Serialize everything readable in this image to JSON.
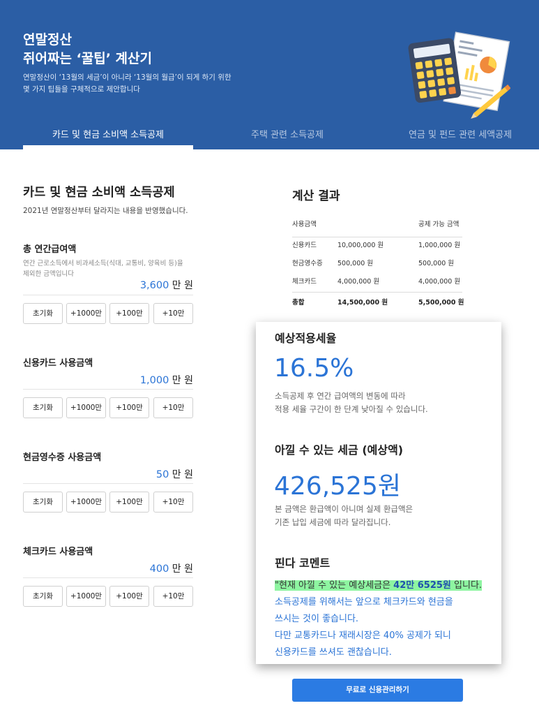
{
  "header": {
    "title_line1": "연말정산",
    "title_line2": "쥐어짜는 ‘꿀팁’ 계산기",
    "desc_line1": "연말정산이 ‘13월의 세금’이 아니라 ‘13월의 월급’이 되게 하기 위한",
    "desc_line2": "몇 가지 팁들을 구체적으로 제안합니다",
    "illustration_icon": "calculator-document-pencil-illustration"
  },
  "tabs": [
    {
      "label": "카드 및 현금 소비액 소득공제",
      "active": true
    },
    {
      "label": "주택 관련 소득공제",
      "active": false
    },
    {
      "label": "연금 및 펀드 관련 세액공제",
      "active": false
    }
  ],
  "form": {
    "title": "카드 및 현금 소비액 소득공제",
    "subtitle": "2021년 연말정산부터 달라지는 내용을 반영했습니다.",
    "unit": "만 원",
    "buttons": [
      "초기화",
      "+1000만",
      "+100만",
      "+10만"
    ],
    "fields": [
      {
        "label": "총 연간급여액",
        "help1": "연간 근로소득에서 비과세소득(식대, 교통비, 양육비 등)을",
        "help2": "제외한 금액입니다",
        "value": "3,600"
      },
      {
        "label": "신용카드 사용금액",
        "value": "1,000"
      },
      {
        "label": "현금영수증 사용금액",
        "value": "50"
      },
      {
        "label": "체크카드 사용금액",
        "value": "400"
      }
    ]
  },
  "result": {
    "title": "계산 결과",
    "header": {
      "used": "사용금액",
      "deductible": "공제 가능 금액"
    },
    "rows": [
      {
        "name": "신용카드",
        "used": "10,000,000 원",
        "deductible": "1,000,000 원"
      },
      {
        "name": "현금영수증",
        "used": "500,000 원",
        "deductible": "500,000 원"
      },
      {
        "name": "체크카드",
        "used": "4,000,000 원",
        "deductible": "4,000,000 원"
      }
    ],
    "total": {
      "name": "총합",
      "used": "14,500,000 원",
      "deductible": "5,500,000 원"
    }
  },
  "card": {
    "rate_title": "예상적용세율",
    "rate_value": "16.5%",
    "rate_desc1": "소득공제 후 연간 급여액의 변동에 따라",
    "rate_desc2": "적용 세율 구간이 한 단계 낮아질 수 있습니다.",
    "save_title": "아낄 수 있는 세금 (예상액)",
    "save_value": "426,525원",
    "save_desc1": "본 금액은 환급액이 아니며 실제 환급액은",
    "save_desc2": "기존 납입 세금에 따라 달라집니다.",
    "comment_title": "핀다 코멘트",
    "comment_hl_pre": "\"현재 아낄 수 있는 예상세금은 ",
    "comment_hl_bold": "42만 6525원",
    "comment_hl_post": " 입니다.",
    "comment_line2": "소득공제를 위해서는 앞으로 체크카드와 현금을",
    "comment_line3": "쓰시는 것이 좋습니다.",
    "comment_line4": "다만 교통카드나 재래시장은 40% 공제가 되니",
    "comment_line5": "신용카드를 쓰셔도 괜찮습니다."
  },
  "cta": {
    "label": "무료로 신용관리하기"
  },
  "colors": {
    "header_bg": "#2b5ea5",
    "accent": "#2b74d6",
    "highlight": "#8ef5a1",
    "cta": "#2b7be3"
  }
}
